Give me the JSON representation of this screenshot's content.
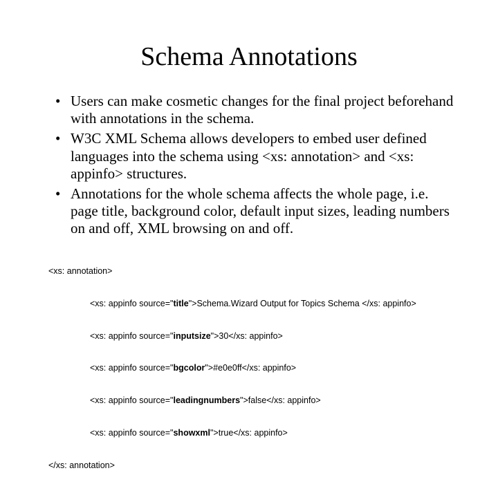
{
  "title": "Schema Annotations",
  "bullets": [
    "Users can make cosmetic changes for the final project beforehand with annotations in the schema.",
    "W3C XML Schema allows developers to embed user defined languages into the schema using <xs: annotation> and <xs: appinfo> structures.",
    "Annotations for the whole schema affects the whole page, i.e. page title, background color, default input sizes, leading numbers on and off, XML browsing on and off."
  ],
  "code": {
    "open": "<xs: annotation>",
    "lines": [
      {
        "prefix": "<xs: appinfo source=\"",
        "source": "title",
        "mid": "\">",
        "value": "Schema.Wizard Output for Topics Schema ",
        "suffix": "</xs: appinfo>"
      },
      {
        "prefix": "<xs: appinfo source=\"",
        "source": "inputsize",
        "mid": "\">",
        "value": "30",
        "suffix": "</xs: appinfo>"
      },
      {
        "prefix": "<xs: appinfo source=\"",
        "source": "bgcolor",
        "mid": "\">",
        "value": "#e0e0ff",
        "suffix": "</xs: appinfo>"
      },
      {
        "prefix": "<xs: appinfo source=\"",
        "source": "leadingnumbers",
        "mid": "\">",
        "value": "false",
        "suffix": "</xs: appinfo>"
      },
      {
        "prefix": "<xs: appinfo source=\"",
        "source": "showxml",
        "mid": "\">",
        "value": "true",
        "suffix": "</xs: appinfo>"
      }
    ],
    "close": "</xs: annotation>"
  }
}
